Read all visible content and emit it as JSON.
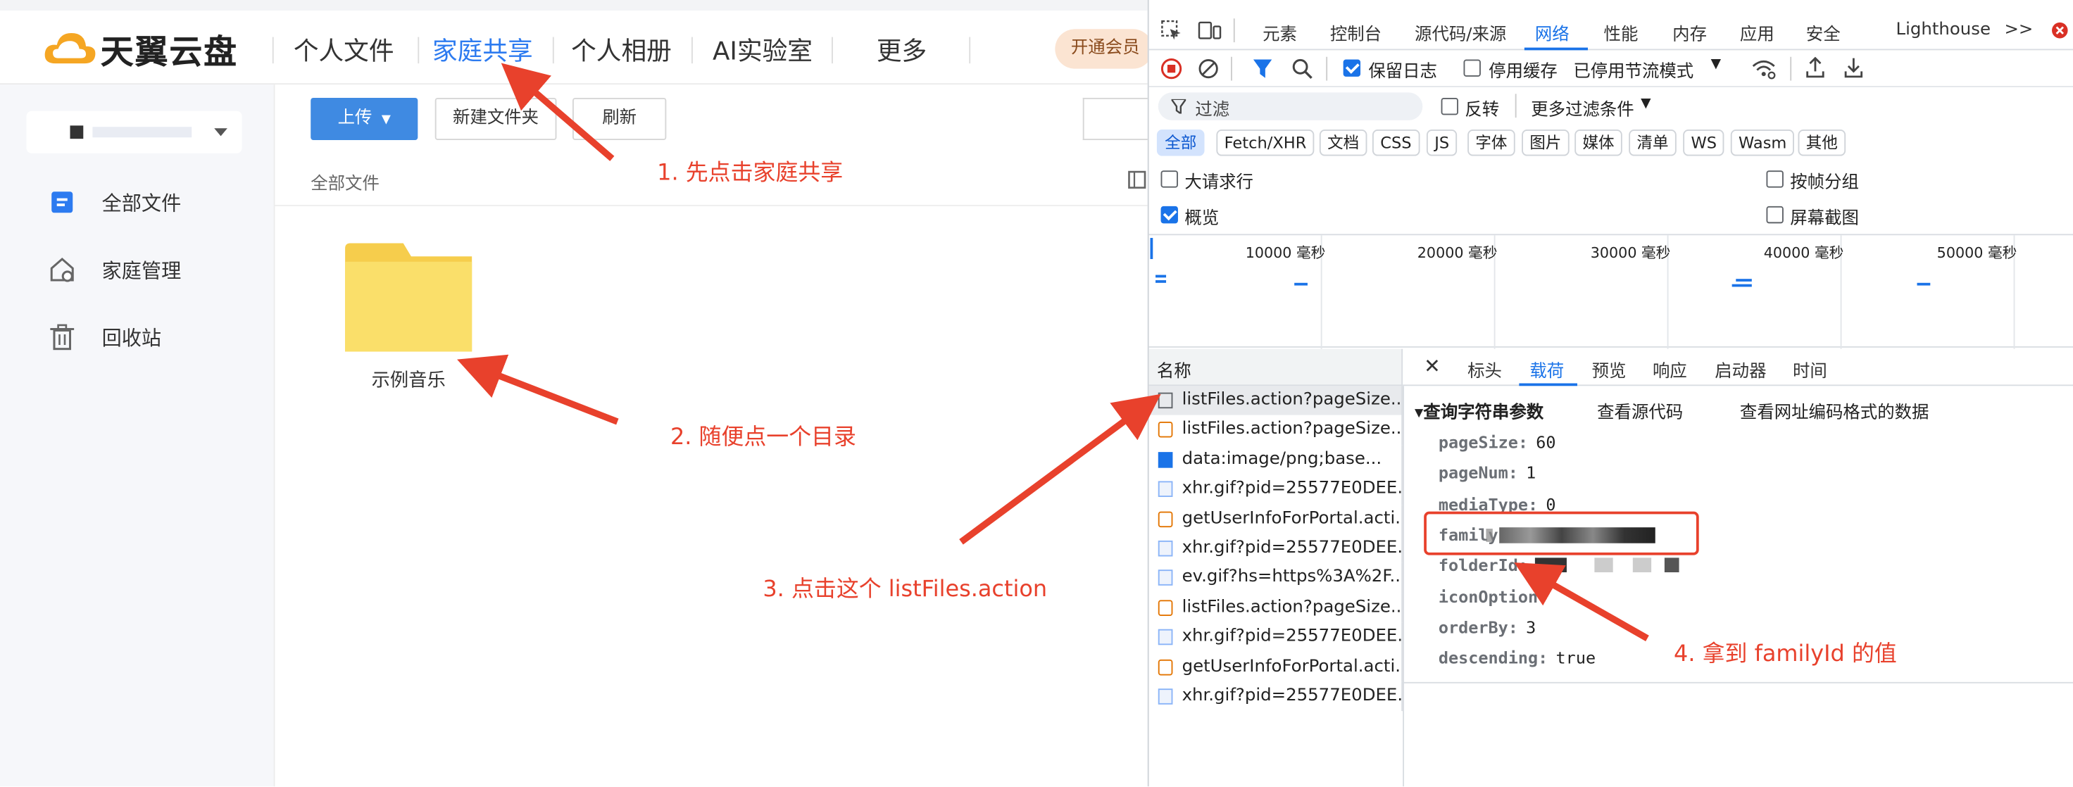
{
  "app": {
    "logo_text": "天翼云盘",
    "nav": [
      "个人文件",
      "家庭共享",
      "个人相册",
      "AI实验室",
      "更多"
    ],
    "vip_label": "开通会员",
    "sidebar": [
      "全部文件",
      "家庭管理",
      "回收站"
    ],
    "toolbar": {
      "upload": "上传",
      "new_folder": "新建文件夹",
      "refresh": "刷新"
    },
    "breadcrumb": "全部文件",
    "folder_name": "示例音乐"
  },
  "annotations": {
    "step1": "1. 先点击家庭共享",
    "step2": "2. 随便点一个目录",
    "step3": "3. 点击这个 listFiles.action",
    "step4": "4. 拿到 familyId 的值"
  },
  "devtools": {
    "tabs": [
      "元素",
      "控制台",
      "源代码/来源",
      "网络",
      "性能",
      "内存",
      "应用",
      "安全",
      "Lighthouse"
    ],
    "more_tabs": ">>",
    "preserve_log": "保留日志",
    "disable_cache": "停用缓存",
    "throttle": "已停用节流模式",
    "filter_placeholder": "过滤",
    "invert": "反转",
    "more_filters": "更多过滤条件",
    "types": [
      "全部",
      "Fetch/XHR",
      "文档",
      "CSS",
      "JS",
      "字体",
      "图片",
      "媒体",
      "清单",
      "WS",
      "Wasm",
      "其他"
    ],
    "big_rows": "大请求行",
    "group_by_frame": "按帧分组",
    "overview": "概览",
    "screenshots": "屏幕截图",
    "timeline_ticks": [
      "10000 毫秒",
      "20000 毫秒",
      "30000 毫秒",
      "40000 毫秒",
      "50000 毫秒"
    ],
    "name_header": "名称",
    "requests": [
      "listFiles.action?pageSize...",
      "listFiles.action?pageSize...",
      "data:image/png;base...",
      "xhr.gif?pid=25577E0DEE...",
      "getUserInfoForPortal.acti...",
      "xhr.gif?pid=25577E0DEE...",
      "ev.gif?hs=https%3A%2F...",
      "listFiles.action?pageSize...",
      "xhr.gif?pid=25577E0DEE...",
      "getUserInfoForPortal.acti...",
      "xhr.gif?pid=25577E0DEE..."
    ],
    "detail_tabs": [
      "标头",
      "载荷",
      "预览",
      "响应",
      "启动器",
      "时间"
    ],
    "close": "✕",
    "section_title": "▾查询字符串参数",
    "view_source": "查看源代码",
    "view_url_encoded": "查看网址编码格式的数据",
    "params": [
      {
        "key": "pageSize:",
        "value": "60"
      },
      {
        "key": "pageNum:",
        "value": "1"
      },
      {
        "key": "mediaType:",
        "value": "0"
      },
      {
        "key": "familyId:",
        "value": ""
      },
      {
        "key": "folderId:",
        "value": ""
      },
      {
        "key": "iconOption:",
        "value": ""
      },
      {
        "key": "orderBy:",
        "value": "3"
      },
      {
        "key": "descending:",
        "value": "true"
      }
    ]
  }
}
